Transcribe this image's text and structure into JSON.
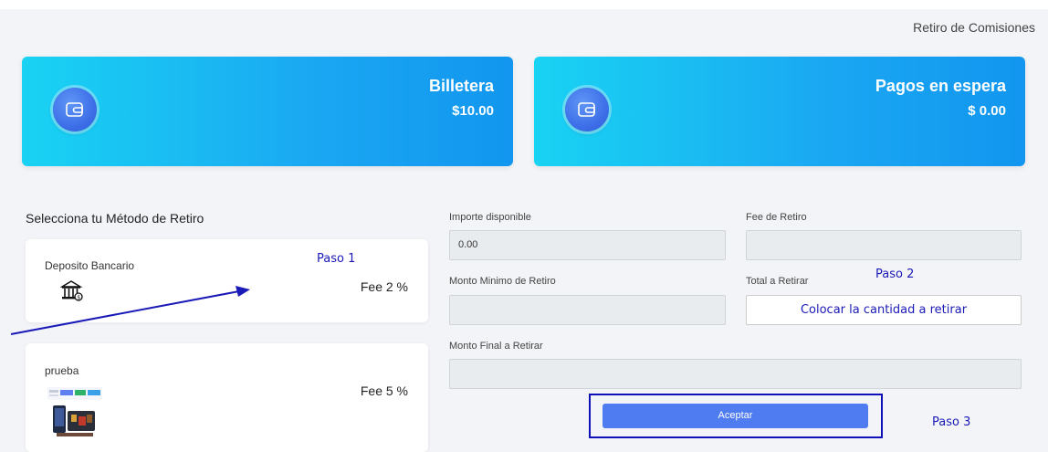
{
  "header": {
    "title": "Retiro de Comisiones"
  },
  "cards": [
    {
      "title": "Billetera",
      "amount": "$10.00",
      "icon": "wallet-icon"
    },
    {
      "title": "Pagos en espera",
      "amount": "$ 0.00",
      "icon": "wallet-icon"
    }
  ],
  "methods": {
    "section_title": "Selecciona tu Método de Retiro",
    "items": [
      {
        "name": "Deposito Bancario",
        "fee": "Fee 2 %",
        "icon": "bank-icon"
      },
      {
        "name": "prueba",
        "fee": "Fee 5 %",
        "icon": "thumbnail-image"
      }
    ]
  },
  "form": {
    "available_label": "Importe disponible",
    "available_value": "0.00",
    "fee_label": "Fee de Retiro",
    "fee_value": "",
    "min_label": "Monto Minimo de Retiro",
    "min_value": "",
    "total_label": "Total a Retirar",
    "total_placeholder": "Colocar la cantidad a retirar",
    "final_label": "Monto Final a Retirar",
    "final_value": "",
    "accept_label": "Aceptar"
  },
  "annotations": {
    "step1": "Paso 1",
    "step2": "Paso 2",
    "step3": "Paso 3",
    "color": "#1a1ab8"
  }
}
